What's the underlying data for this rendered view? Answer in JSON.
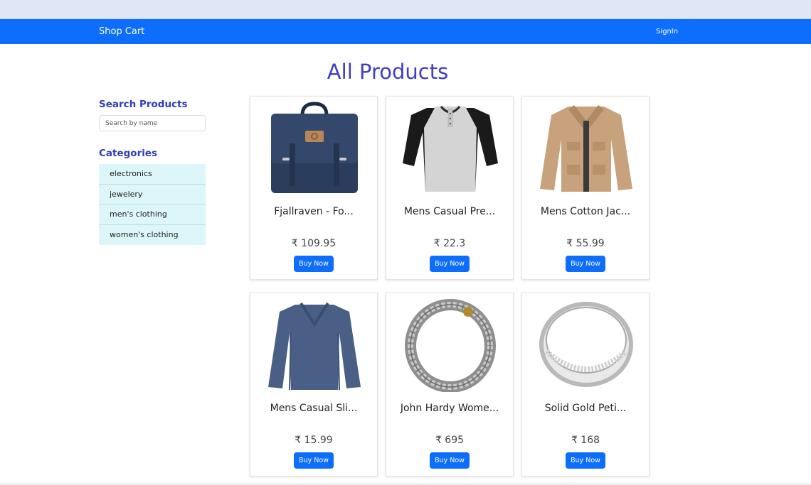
{
  "navbar": {
    "brand": "Shop Cart",
    "signin": "SignIn"
  },
  "main": {
    "title": "All Products"
  },
  "sidebar": {
    "search_heading": "Search Products",
    "search_placeholder": "Search by name",
    "categories_heading": "Categories",
    "categories": [
      "electronics",
      "jewelery",
      "men's clothing",
      "women's clothing"
    ]
  },
  "products": [
    {
      "name": "Fjallraven - Fo...",
      "price": "₹ 109.95",
      "button": "Buy Now",
      "image": "backpack"
    },
    {
      "name": "Mens Casual Pre...",
      "price": "₹ 22.3",
      "button": "Buy Now",
      "image": "raglan-tshirt"
    },
    {
      "name": "Mens Cotton Jac...",
      "price": "₹ 55.99",
      "button": "Buy Now",
      "image": "cotton-jacket"
    },
    {
      "name": "Mens Casual Sli...",
      "price": "₹ 15.99",
      "button": "Buy Now",
      "image": "slim-longsleeve"
    },
    {
      "name": "John Hardy Wome...",
      "price": "₹ 695",
      "button": "Buy Now",
      "image": "chain-bracelet"
    },
    {
      "name": "Solid Gold Peti...",
      "price": "₹ 168",
      "button": "Buy Now",
      "image": "silver-ring"
    }
  ],
  "colors": {
    "navbar": "#0d6efd",
    "heading": "#2e3bb8",
    "title": "#3f3fbf",
    "category_bg": "#ddf6f9"
  }
}
